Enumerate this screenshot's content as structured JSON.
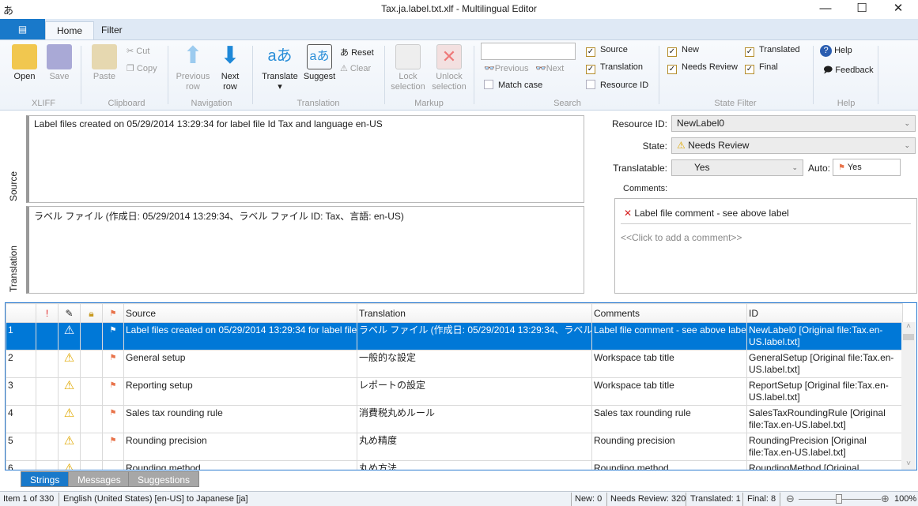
{
  "window": {
    "title": "Tax.ja.label.txt.xlf - Multilingual Editor",
    "minimize": "—",
    "maximize": "☐",
    "close": "✕"
  },
  "tabs": [
    {
      "label": "Home"
    },
    {
      "label": "Filter"
    }
  ],
  "ribbon": {
    "xliff": {
      "group": "XLIFF",
      "open": "Open",
      "save": "Save"
    },
    "clipboard": {
      "group": "Clipboard",
      "paste": "Paste",
      "cut": "Cut",
      "copy": "Copy"
    },
    "navigation": {
      "group": "Navigation",
      "previous": "Previous row",
      "next": "Next row"
    },
    "translation": {
      "group": "Translation",
      "translate": "Translate",
      "suggest": "Suggest",
      "reset": "Reset",
      "clear": "Clear"
    },
    "markup": {
      "group": "Markup",
      "lock": "Lock selection",
      "unlock": "Unlock selection"
    },
    "search": {
      "group": "Search",
      "value": "",
      "previous": "Previous",
      "next": "Next",
      "match_case": "Match case",
      "source": "Source",
      "translation": "Translation",
      "resource_id": "Resource ID",
      "source_checked": true,
      "translation_checked": true,
      "resource_id_checked": false,
      "match_case_checked": false
    },
    "state_filter": {
      "group": "State Filter",
      "new": "New",
      "needs_review": "Needs Review",
      "translated": "Translated",
      "final": "Final"
    },
    "help": {
      "group": "Help",
      "help": "Help",
      "feedback": "Feedback"
    }
  },
  "editor": {
    "source_label": "Source",
    "translation_label": "Translation",
    "source_text": "Label files created on 05/29/2014 13:29:34 for label file Id Tax and language en-US",
    "translation_text": "ラベル ファイル (作成日: 05/29/2014 13:29:34、ラベル ファイル ID: Tax、言語: en-US)"
  },
  "properties": {
    "resource_id_label": "Resource ID:",
    "resource_id": "NewLabel0",
    "state_label": "State:",
    "state": "Needs Review",
    "translatable_label": "Translatable:",
    "translatable": "Yes",
    "auto_label": "Auto:",
    "auto": "Yes",
    "comments_label": "Comments:",
    "comment": "Label file comment - see above label",
    "add_comment": "<<Click to add a comment>>"
  },
  "grid": {
    "columns": [
      "!",
      "",
      "",
      "",
      "Source",
      "Translation",
      "Comments",
      "ID"
    ],
    "rows": [
      {
        "n": "1",
        "source": "Label files created on 05/29/2014 13:29:34 for label file",
        "translation": "ラベル ファイル (作成日: 05/29/2014 13:29:34、ラベル ファイル",
        "comments": "Label file comment - see above label",
        "id": "NewLabel0 [Original file:Tax.en-US.label.txt]"
      },
      {
        "n": "2",
        "source": "General setup",
        "translation": "一般的な設定",
        "comments": "Workspace tab title",
        "id": "GeneralSetup [Original file:Tax.en-US.label.txt]"
      },
      {
        "n": "3",
        "source": "Reporting setup",
        "translation": "レポートの設定",
        "comments": "Workspace tab title",
        "id": "ReportSetup [Original file:Tax.en-US.label.txt]"
      },
      {
        "n": "4",
        "source": "Sales tax rounding rule",
        "translation": "消費税丸めルール",
        "comments": "Sales tax rounding rule",
        "id": "SalesTaxRoundingRule [Original file:Tax.en-US.label.txt]"
      },
      {
        "n": "5",
        "source": "Rounding precision",
        "translation": "丸め精度",
        "comments": "Rounding precision",
        "id": "RoundingPrecision [Original file:Tax.en-US.label.txt]"
      },
      {
        "n": "6",
        "source": "Rounding method",
        "translation": "丸め方法",
        "comments": "Rounding method",
        "id": "RoundingMethod [Original"
      }
    ]
  },
  "bottom_tabs": [
    "Strings",
    "Messages",
    "Suggestions"
  ],
  "status": {
    "item": "Item 1 of 330",
    "languages": "English (United States) [en-US] to Japanese [ja]",
    "new": "New: 0",
    "needs_review": "Needs Review: 320",
    "translated": "Translated: 1",
    "final": "Final: 8",
    "zoom": "100%",
    "zoom_percent": 100
  },
  "colors": {
    "accent": "#0078d7",
    "warning": "#f5c400",
    "flag": "#e8734a"
  }
}
